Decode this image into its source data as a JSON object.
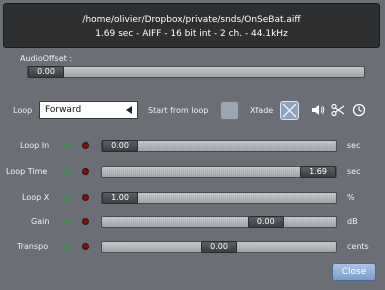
{
  "file_info": {
    "path": "/home/olivier/Dropbox/private/snds/OnSeBat.aiff",
    "details": "1.69 sec - AIFF - 16 bit int - 2 ch. - 44.1kHz"
  },
  "audio_offset": {
    "label": "AudioOffset :",
    "value": "0.00",
    "fraction": 0.0
  },
  "loop": {
    "label": "Loop",
    "mode": "Forward",
    "start_from_loop_label": "Start from loop",
    "start_from_loop_checked": false,
    "xfade_label": "Xfade",
    "xfade_checked": true
  },
  "icons": [
    "speaker-icon",
    "scissors-icon",
    "clock-icon"
  ],
  "params": [
    {
      "label": "Loop In",
      "value": "0.00",
      "unit": "sec",
      "fraction": 0.0
    },
    {
      "label": "Loop Time",
      "value": "1.69",
      "unit": "sec",
      "fraction": 1.0
    },
    {
      "label": "Loop X",
      "value": "1.00",
      "unit": "%",
      "fraction": 0.0
    },
    {
      "label": "Gain",
      "value": "0.00",
      "unit": "dB",
      "fraction": 0.7
    },
    {
      "label": "Transpo",
      "value": "0.00",
      "unit": "cents",
      "fraction": 0.5
    }
  ],
  "close_label": "Close",
  "colors": {
    "background": "#6b6e74",
    "info_box": "#2e2f31",
    "play_green": "#2f9a3a",
    "record_red": "#7a1212",
    "close_button": "#8fb0da"
  }
}
